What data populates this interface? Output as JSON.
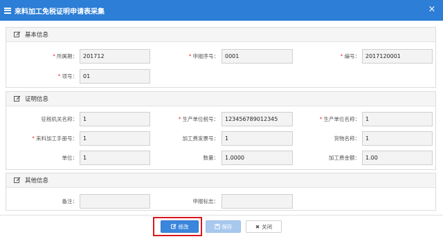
{
  "window": {
    "title": "来料加工免税证明申请表采集",
    "close_glyph": "×"
  },
  "sections": {
    "basic": {
      "title": "基本信息"
    },
    "cert": {
      "title": "证明信息"
    },
    "other": {
      "title": "其他信息"
    }
  },
  "fields": {
    "period": {
      "label": "所属期：",
      "value": "201712"
    },
    "seq": {
      "label": "申报序号：",
      "value": "0001"
    },
    "number": {
      "label": "编号：",
      "value": "2017120001"
    },
    "item": {
      "label": "项号：",
      "value": "01"
    },
    "tax_authority": {
      "label": "征税机关名称：",
      "value": "1"
    },
    "producer_tax_no": {
      "label": "生产单位税号：",
      "value": "123456789012345"
    },
    "producer_name": {
      "label": "生产单位名称：",
      "value": "1"
    },
    "handbook_no": {
      "label": "来料加工手册号：",
      "value": "1"
    },
    "invoice_no": {
      "label": "加工费发票号：",
      "value": "1"
    },
    "goods_name": {
      "label": "货物名称：",
      "value": "1"
    },
    "unit": {
      "label": "单位：",
      "value": "1"
    },
    "quantity": {
      "label": "数量：",
      "value": "1.0000"
    },
    "fee_amount": {
      "label": "加工费金额：",
      "value": "1.00"
    },
    "remark": {
      "label": "备注：",
      "value": ""
    },
    "declare_flag": {
      "label": "申报标志：",
      "value": ""
    }
  },
  "required_mark": "*",
  "buttons": {
    "edit": "修改",
    "save": "保存",
    "close": "关闭"
  },
  "colors": {
    "titlebar": "#2c7ed6",
    "primary": "#3b86dd",
    "required": "#e4393c",
    "highlight": "#d9171b"
  }
}
